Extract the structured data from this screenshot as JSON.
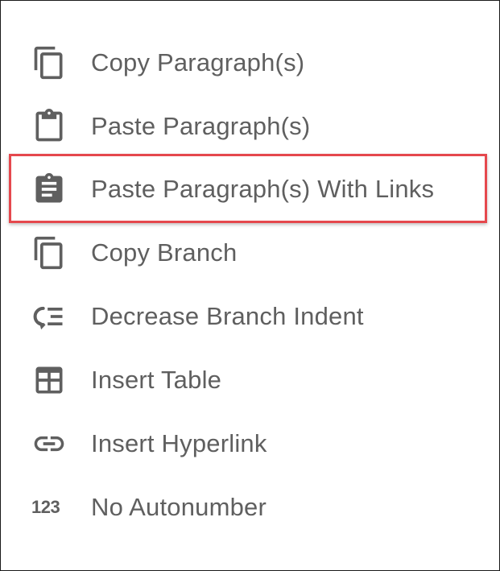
{
  "menu": {
    "items": [
      {
        "label": "Copy Paragraph(s)",
        "icon": "content-copy-icon"
      },
      {
        "label": "Paste Paragraph(s)",
        "icon": "clipboard-outline-icon"
      },
      {
        "label": "Paste Paragraph(s) With Links",
        "icon": "clipboard-text-icon"
      },
      {
        "label": "Copy Branch",
        "icon": "content-copy-icon"
      },
      {
        "label": "Decrease Branch Indent",
        "icon": "format-indent-decrease-icon"
      },
      {
        "label": "Insert Table",
        "icon": "table-icon"
      },
      {
        "label": "Insert Hyperlink",
        "icon": "link-icon"
      },
      {
        "label": "No Autonumber",
        "icon": "numeric-icon",
        "icon_text": "123"
      }
    ],
    "highlighted_index": 2
  },
  "colors": {
    "text": "#5f5f5f",
    "icon": "#5f5f5f",
    "highlight_border": "#e5484d",
    "frame_border": "#1a1a1a"
  }
}
